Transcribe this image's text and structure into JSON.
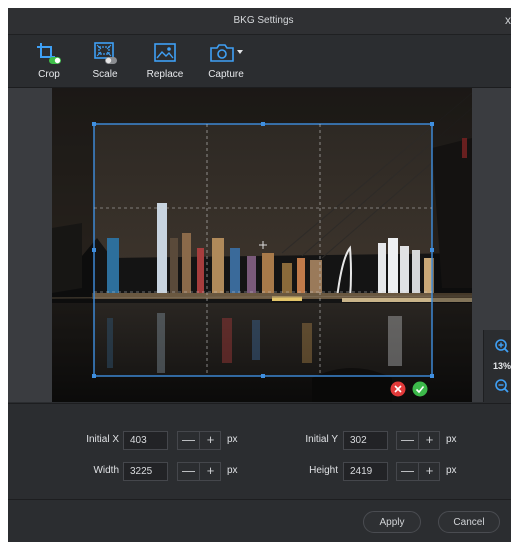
{
  "window": {
    "title": "BKG Settings",
    "close_glyph": "x"
  },
  "toolbar": {
    "tools": [
      {
        "label": "Crop",
        "icon": "crop-icon"
      },
      {
        "label": "Scale",
        "icon": "scale-icon"
      },
      {
        "label": "Replace",
        "icon": "image-replace-icon"
      },
      {
        "label": "Capture",
        "icon": "camera-icon"
      }
    ]
  },
  "zoom": {
    "value": "13%"
  },
  "fields": {
    "initial_x": {
      "label": "Initial X",
      "value": "403",
      "unit": "px"
    },
    "initial_y": {
      "label": "Initial Y",
      "value": "302",
      "unit": "px"
    },
    "width": {
      "label": "Width",
      "value": "3225",
      "unit": "px"
    },
    "height": {
      "label": "Height",
      "value": "2419",
      "unit": "px"
    },
    "minus_glyph": "—",
    "plus_glyph": "+"
  },
  "footer": {
    "apply": "Apply",
    "cancel": "Cancel"
  },
  "colors": {
    "accent": "#3fa0f5",
    "toggle_on": "#3fbf4a",
    "cancel_red": "#e23a3a",
    "confirm_green": "#3cb94a"
  }
}
